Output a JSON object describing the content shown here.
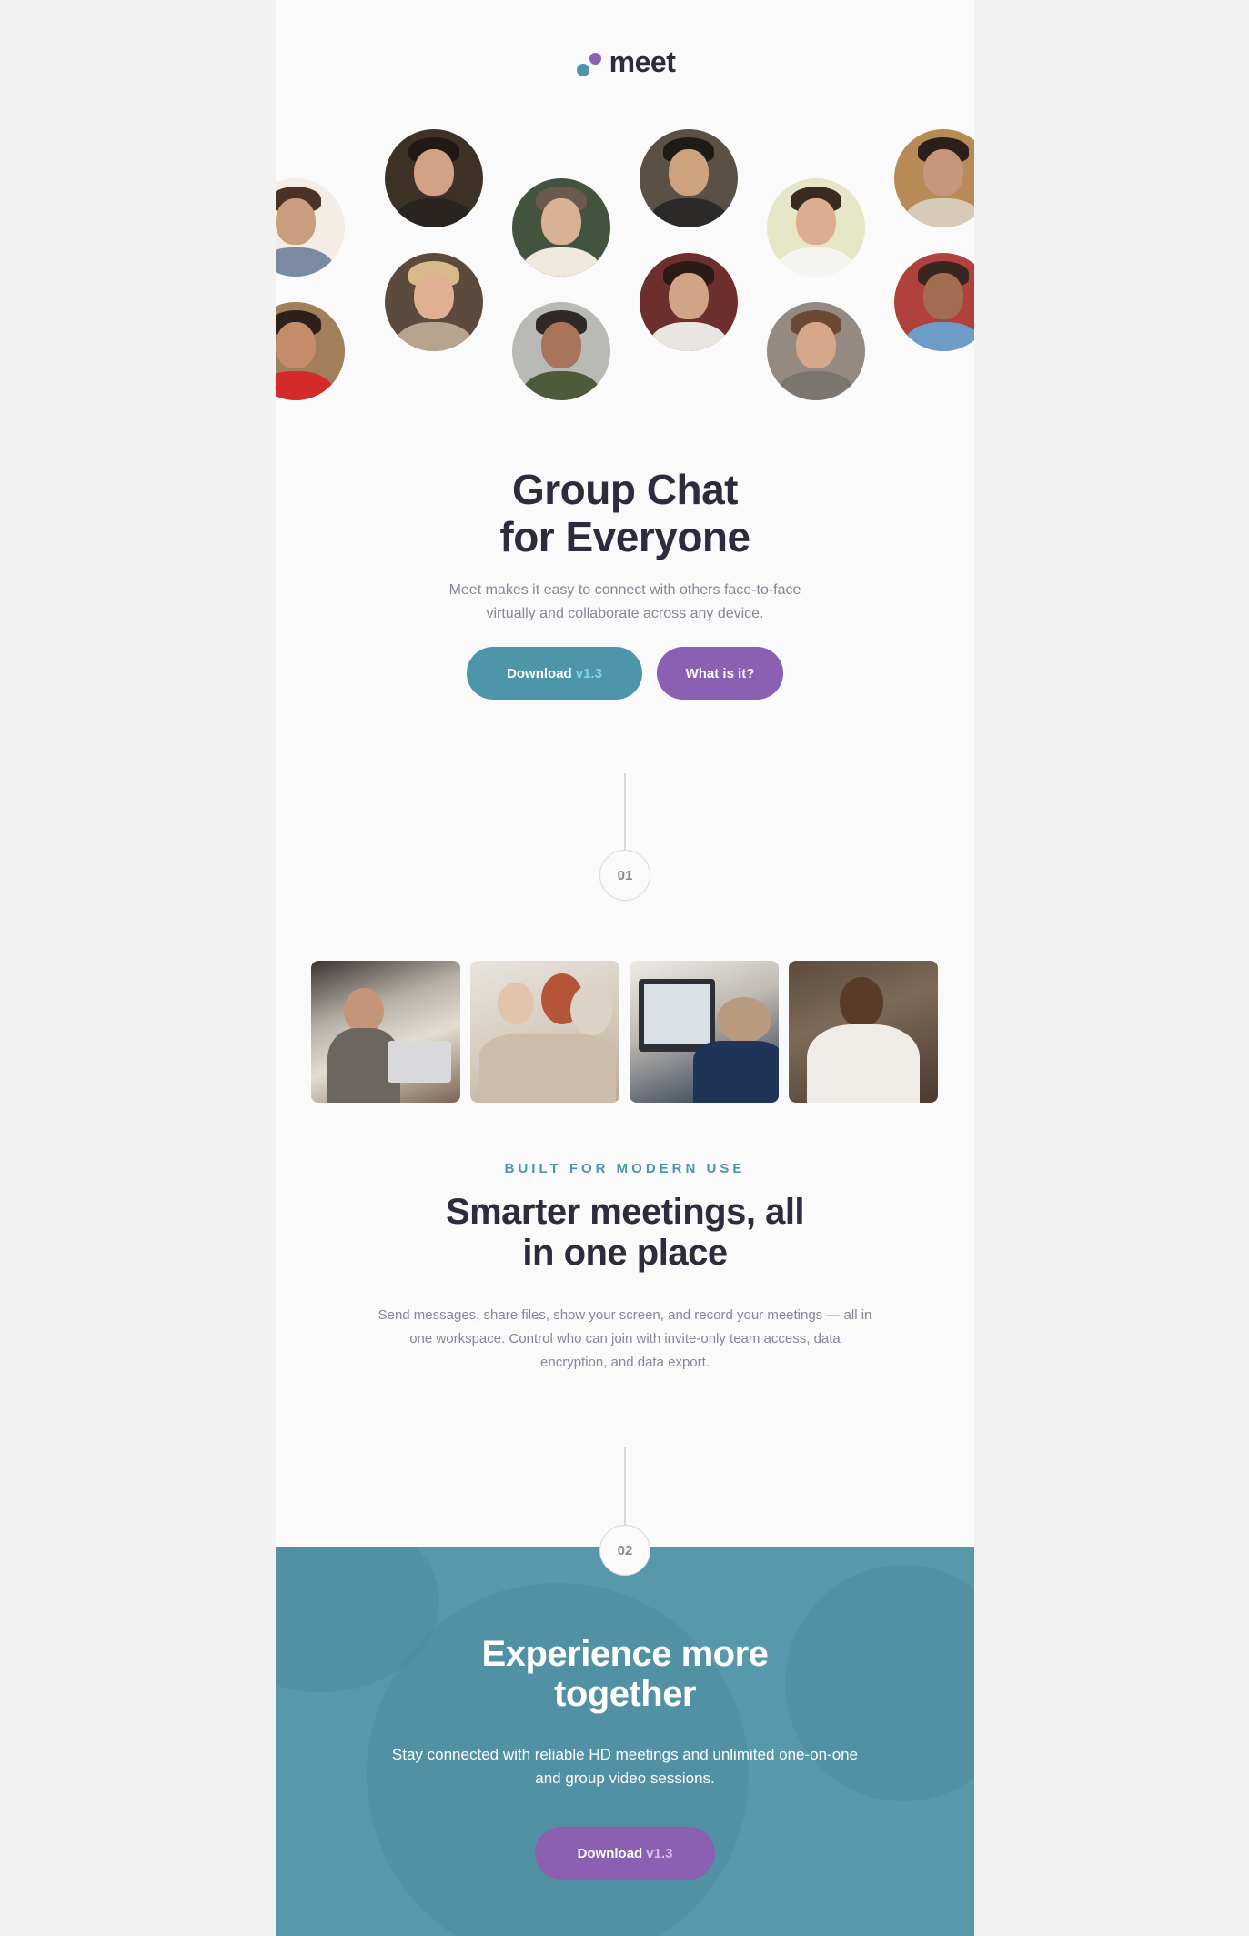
{
  "brand": {
    "name": "meet",
    "colors": {
      "teal": "#4d96a9",
      "purple": "#8b5fb2",
      "dark": "#2c2c3c"
    }
  },
  "hero": {
    "title_line1": "Group Chat",
    "title_line2": "for Everyone",
    "subtitle_line1": "Meet makes it easy to connect with others face-to-face",
    "subtitle_line2": "virtually and collaborate across any device.",
    "download_label": "Download",
    "download_version": "v1.3",
    "what_label": "What is it?"
  },
  "steps": {
    "one": "01",
    "two": "02"
  },
  "features": {
    "eyebrow": "BUILT FOR MODERN USE",
    "title_line1": "Smarter meetings, all",
    "title_line2": "in one place",
    "body_line1": "Send messages, share files, show your screen, and record your meetings — all in",
    "body_line2": "one workspace. Control who can join with invite-only team access, data",
    "body_line3": "encryption, and data export."
  },
  "cta": {
    "title_line1": "Experience more",
    "title_line2": "together",
    "body_line1": "Stay connected with reliable HD meetings and unlimited one-on-one",
    "body_line2": "and group video sessions.",
    "download_label": "Download",
    "download_version": "v1.3"
  }
}
